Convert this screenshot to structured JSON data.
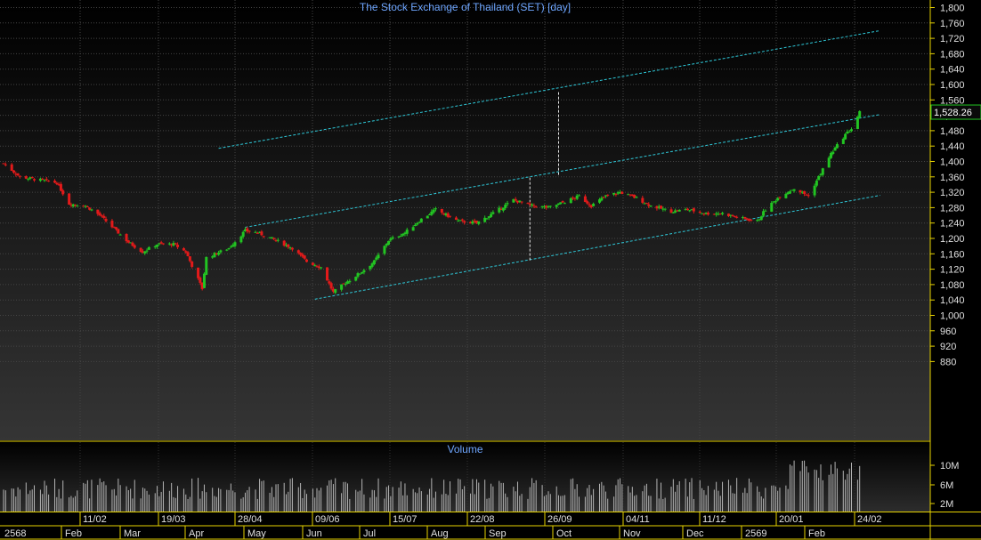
{
  "title": "The Stock Exchange of Thailand (SET) [day]",
  "volume_title": "Volume",
  "last_price_label": "1,528.26",
  "colors": {
    "background": "#000000",
    "up": "#22c422",
    "down": "#e21a1a",
    "channel": "#2ec8d8",
    "axis_text": "#e0e0e0",
    "title_text": "#6ea6ff",
    "frame": "#e6d200",
    "volume_bar": "#b4b4b4"
  },
  "chart_data": [
    {
      "type": "candlestick",
      "title": "The Stock Exchange of Thailand (SET) [day]",
      "ylim": [
        850,
        1810
      ],
      "yticks": [
        "1,800",
        "1,760",
        "1,720",
        "1,680",
        "1,640",
        "1,600",
        "1,560",
        "1,520",
        "1,480",
        "1,440",
        "1,400",
        "1,360",
        "1,320",
        "1,280",
        "1,240",
        "1,200",
        "1,160",
        "1,120",
        "1,080",
        "1,040",
        "1,000",
        "960",
        "920",
        "880"
      ],
      "date_ticks": [
        "11/02",
        "19/03",
        "28/04",
        "09/06",
        "15/07",
        "22/08",
        "26/09",
        "04/11",
        "11/12",
        "20/01",
        "24/02"
      ],
      "month_ticks": [
        "2568",
        "Feb",
        "Mar",
        "Apr",
        "May",
        "Jun",
        "Jul",
        "Aug",
        "Sep",
        "Oct",
        "Nov",
        "Dec",
        "2569",
        "Feb"
      ],
      "last_close": 1528.26,
      "close_path": [
        [
          "2025-01-02",
          1395
        ],
        [
          "2025-01-10",
          1360
        ],
        [
          "2025-01-22",
          1350
        ],
        [
          "2025-01-28",
          1345
        ],
        [
          "2025-02-03",
          1290
        ],
        [
          "2025-02-11",
          1285
        ],
        [
          "2025-02-18",
          1260
        ],
        [
          "2025-02-25",
          1225
        ],
        [
          "2025-03-04",
          1190
        ],
        [
          "2025-03-11",
          1165
        ],
        [
          "2025-03-18",
          1185
        ],
        [
          "2025-03-26",
          1185
        ],
        [
          "2025-04-01",
          1165
        ],
        [
          "2025-04-09",
          1070
        ],
        [
          "2025-04-11",
          1150
        ],
        [
          "2025-04-22",
          1175
        ],
        [
          "2025-04-30",
          1220
        ],
        [
          "2025-05-06",
          1215
        ],
        [
          "2025-05-15",
          1195
        ],
        [
          "2025-05-23",
          1175
        ],
        [
          "2025-05-30",
          1140
        ],
        [
          "2025-06-06",
          1125
        ],
        [
          "2025-06-12",
          1060
        ],
        [
          "2025-06-18",
          1085
        ],
        [
          "2025-06-25",
          1110
        ],
        [
          "2025-07-02",
          1140
        ],
        [
          "2025-07-09",
          1195
        ],
        [
          "2025-07-17",
          1215
        ],
        [
          "2025-07-25",
          1250
        ],
        [
          "2025-08-01",
          1275
        ],
        [
          "2025-08-12",
          1245
        ],
        [
          "2025-08-21",
          1240
        ],
        [
          "2025-08-29",
          1265
        ],
        [
          "2025-09-08",
          1300
        ],
        [
          "2025-09-17",
          1285
        ],
        [
          "2025-09-25",
          1280
        ],
        [
          "2025-10-03",
          1295
        ],
        [
          "2025-10-10",
          1310
        ],
        [
          "2025-10-16",
          1285
        ],
        [
          "2025-10-23",
          1310
        ],
        [
          "2025-10-30",
          1320
        ],
        [
          "2025-11-07",
          1305
        ],
        [
          "2025-11-14",
          1285
        ],
        [
          "2025-11-24",
          1270
        ],
        [
          "2025-12-02",
          1275
        ],
        [
          "2025-12-11",
          1265
        ],
        [
          "2025-12-19",
          1265
        ],
        [
          "2025-12-26",
          1255
        ],
        [
          "2026-01-05",
          1245
        ],
        [
          "2026-01-09",
          1275
        ],
        [
          "2026-01-16",
          1310
        ],
        [
          "2026-01-23",
          1330
        ],
        [
          "2026-01-30",
          1310
        ],
        [
          "2026-02-04",
          1360
        ],
        [
          "2026-02-10",
          1420
        ],
        [
          "2026-02-17",
          1470
        ],
        [
          "2026-02-20",
          1485
        ],
        [
          "2026-02-24",
          1528
        ]
      ],
      "channel_lines": [
        [
          [
            "2025-04-17",
            1434
          ],
          [
            "2026-03-06",
            1740
          ]
        ],
        [
          [
            "2025-04-30",
            1229
          ],
          [
            "2026-03-06",
            1522
          ]
        ],
        [
          [
            "2025-06-03",
            1042
          ],
          [
            "2026-03-06",
            1312
          ]
        ]
      ],
      "channel_markers": [
        [
          [
            "2025-09-30",
            1580
          ],
          [
            "2025-09-30",
            1365
          ]
        ],
        [
          [
            "2025-09-16",
            1358
          ],
          [
            "2025-09-16",
            1143
          ]
        ]
      ]
    },
    {
      "type": "bar",
      "title": "Volume",
      "yticks": [
        "10M",
        "6M",
        "2M"
      ]
    }
  ]
}
